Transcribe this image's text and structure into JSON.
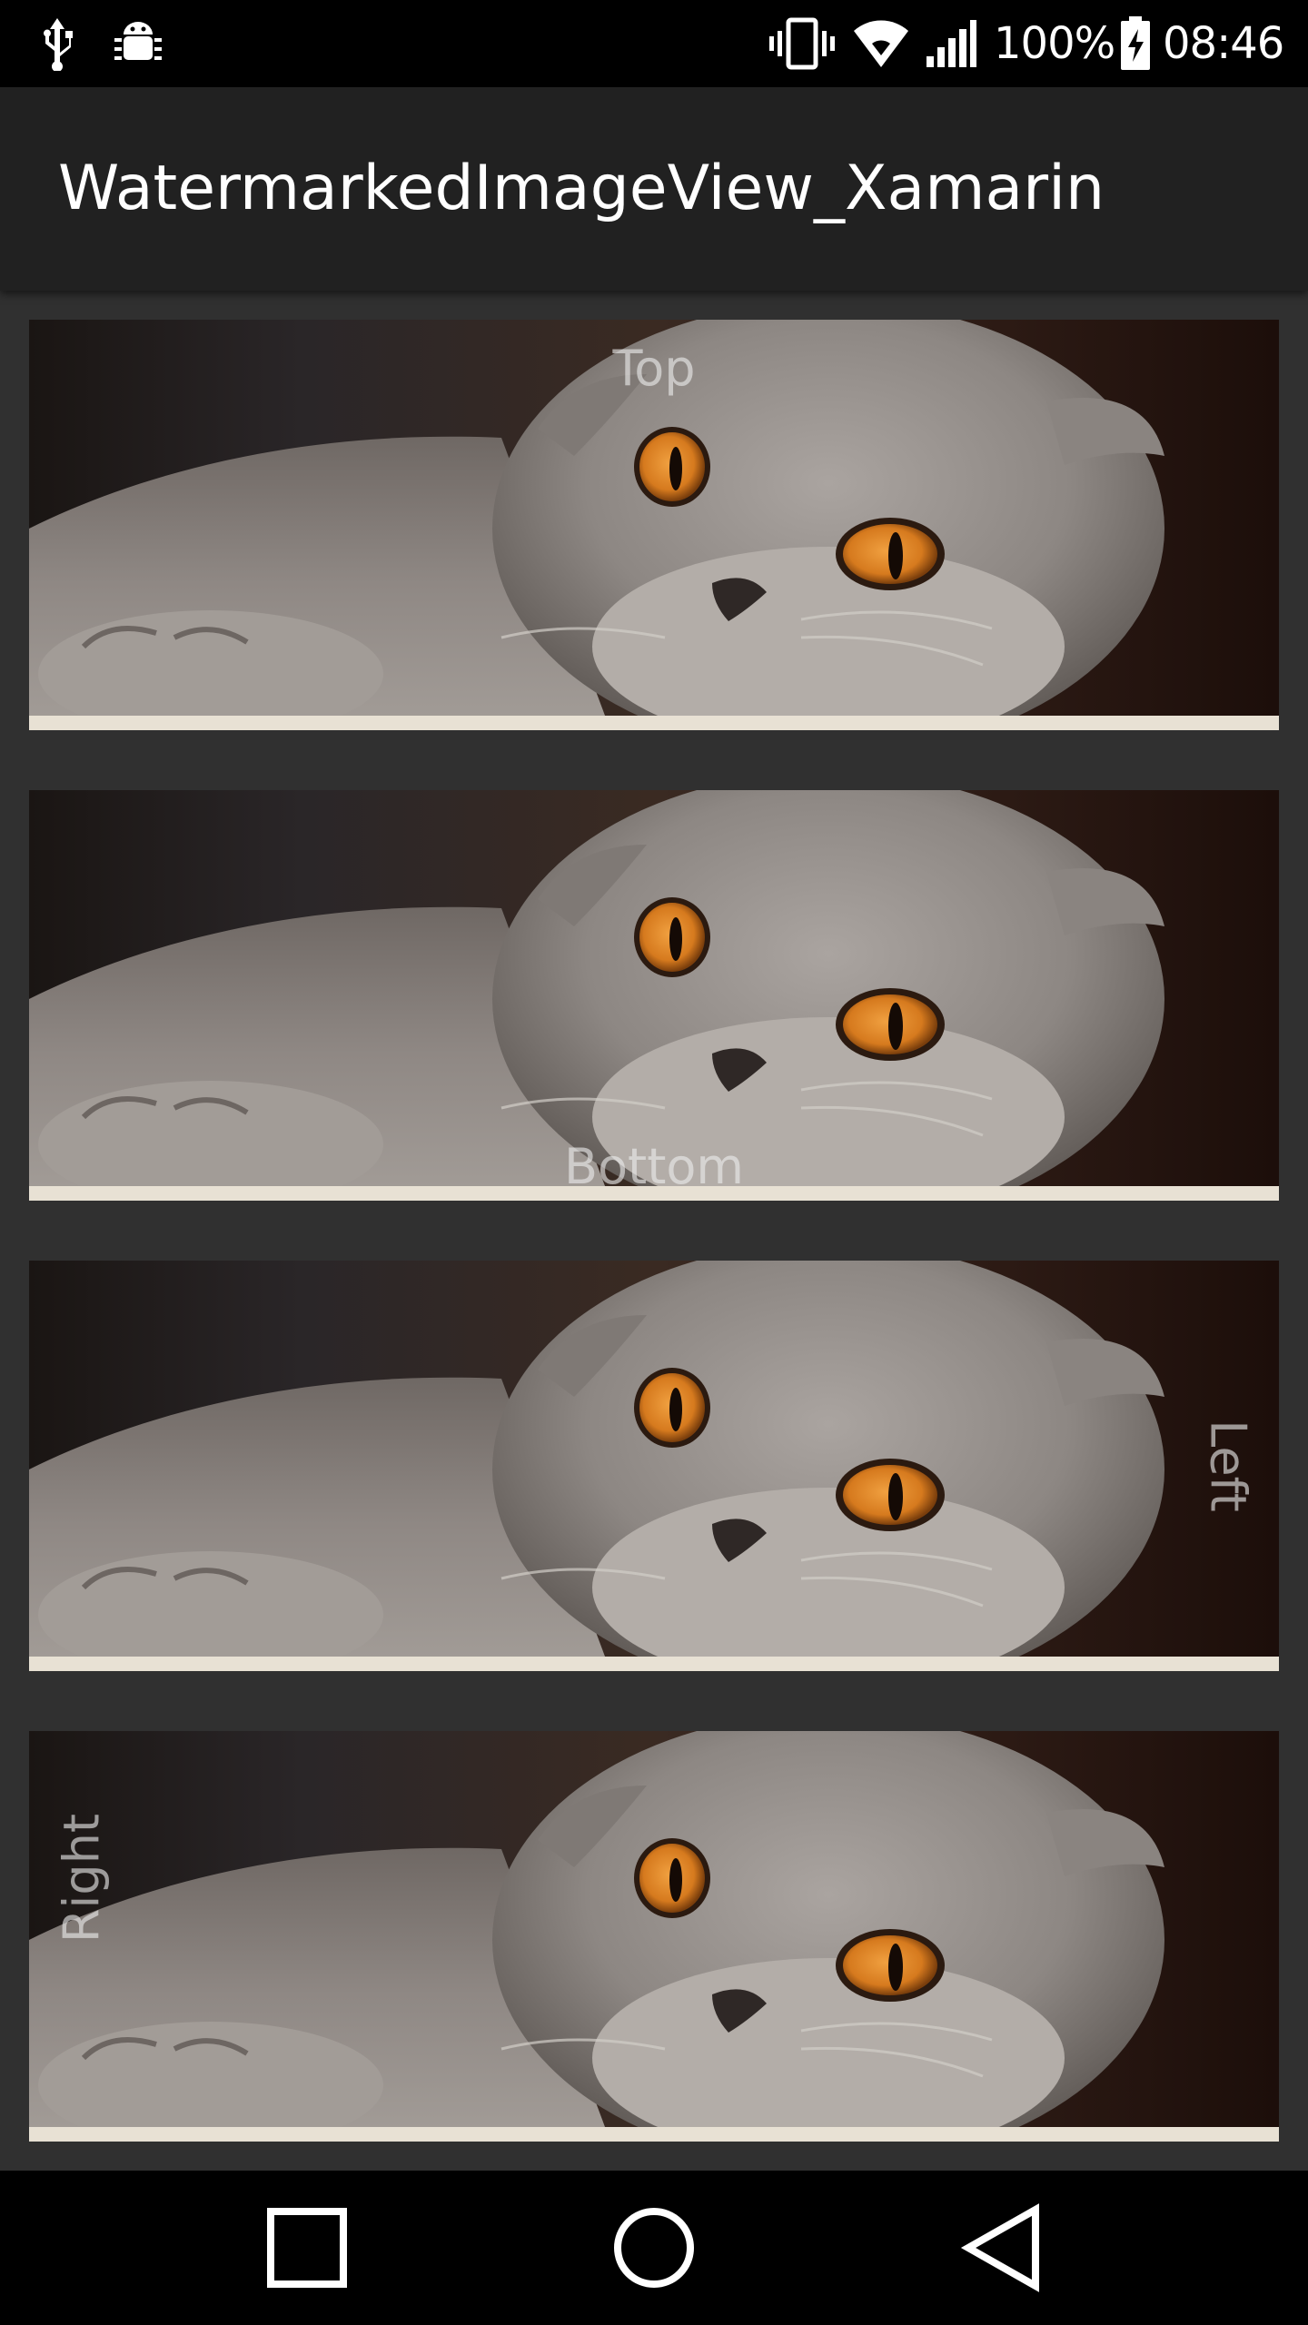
{
  "status_bar": {
    "battery": "100%",
    "time": "08:46",
    "icons": [
      "usb-icon",
      "android-debug-icon",
      "vibrate-icon",
      "wifi-icon",
      "signal-icon",
      "battery-charging-icon"
    ]
  },
  "app_bar": {
    "title": "WatermarkedImageView_Xamarin"
  },
  "cards": [
    {
      "watermark": "Top",
      "position": "top"
    },
    {
      "watermark": "Bottom",
      "position": "bottom"
    },
    {
      "watermark": "Left",
      "position": "right-edge-rotated"
    },
    {
      "watermark": "Right",
      "position": "left-edge-rotated"
    }
  ],
  "nav_bar": {
    "icons": [
      "recents-icon",
      "home-icon",
      "back-icon"
    ]
  },
  "colors": {
    "status_bar": "#000000",
    "app_bar": "#212121",
    "background": "#303030",
    "cat_eye": "#d67a1e"
  }
}
